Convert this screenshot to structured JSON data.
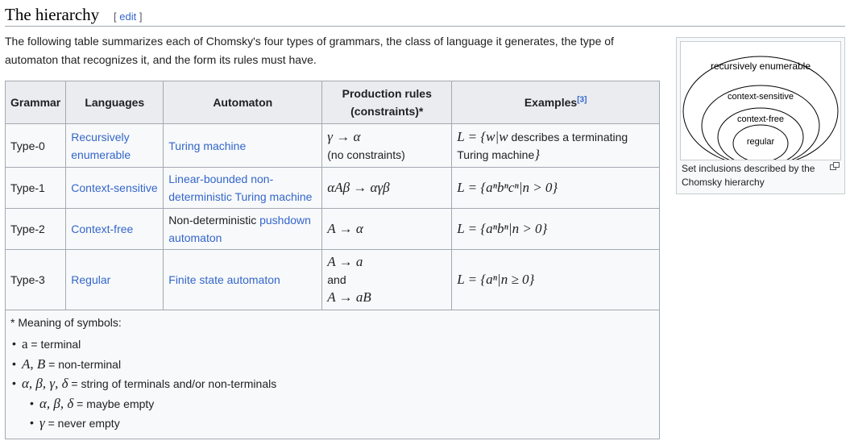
{
  "heading": {
    "title": "The hierarchy",
    "edit_open": "[",
    "edit_label": "edit",
    "edit_close": "]"
  },
  "intro": "The following table summarizes each of Chomsky's four types of grammars, the class of language it generates, the type of automaton that recognizes it, and the form its rules must have.",
  "table": {
    "headers": [
      "Grammar",
      "Languages",
      "Automaton",
      "Production rules (constraints)*",
      "Examples"
    ],
    "examples_ref": "[3]",
    "rows": [
      {
        "grammar": "Type-0",
        "language": "Recursively enumerable",
        "automaton_link": "Turing machine",
        "rule": "γ → α",
        "rule_note": "(no constraints)",
        "example_pre": "L = {w|w",
        "example_text": "describes a terminating Turing machine",
        "example_post": "}"
      },
      {
        "grammar": "Type-1",
        "language": "Context-sensitive",
        "automaton_link": "Linear-bounded non-deterministic Turing machine",
        "rule": "αAβ → αγβ",
        "example": "L = {aⁿbⁿcⁿ|n > 0}"
      },
      {
        "grammar": "Type-2",
        "language": "Context-free",
        "automaton_prefix": "Non-deterministic",
        "automaton_link": "pushdown automaton",
        "rule": "A → α",
        "example": "L = {aⁿbⁿ|n > 0}"
      },
      {
        "grammar": "Type-3",
        "language": "Regular",
        "automaton_link": "Finite state automaton",
        "rule_a": "A → a",
        "rule_and": "and",
        "rule_b": "A → aB",
        "example": "L = {aⁿ|n ≥ 0}"
      }
    ],
    "legend": {
      "title": "* Meaning of symbols:",
      "items": [
        {
          "sym": "a",
          "desc": " = terminal"
        },
        {
          "sym": "A, B",
          "desc": " = non-terminal"
        },
        {
          "sym": "α, β, γ, δ",
          "desc": " = string of terminals and/or non-terminals"
        }
      ],
      "sub_items": [
        {
          "sym": "α, β, δ",
          "desc": " = maybe empty"
        },
        {
          "sym": "γ",
          "desc": " = never empty"
        }
      ]
    }
  },
  "infobox": {
    "sets": [
      "recursively enumerable",
      "context-sensitive",
      "context-free",
      "regular"
    ],
    "caption": "Set inclusions described by the Chomsky hierarchy",
    "icon": "magnify-icon"
  }
}
